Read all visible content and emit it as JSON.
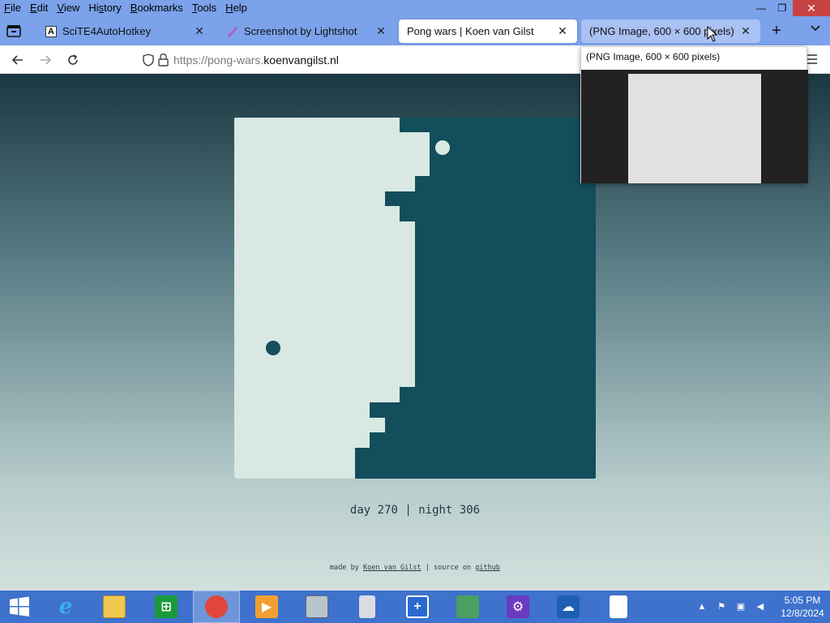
{
  "menu": {
    "items": [
      "File",
      "Edit",
      "View",
      "History",
      "Bookmarks",
      "Tools",
      "Help"
    ],
    "mnemonics": [
      "F",
      "E",
      "V",
      "s",
      "B",
      "T",
      "H"
    ]
  },
  "window": {
    "minimize": "—",
    "restore": "❐",
    "close": "✕"
  },
  "tabs": [
    {
      "title": "SciTE4AutoHotkey",
      "favicon": "A",
      "state": "normal"
    },
    {
      "title": "Screenshot by Lightshot",
      "favicon": "feather",
      "state": "normal"
    },
    {
      "title": "Pong wars | Koen van Gilst",
      "favicon": "none",
      "state": "active"
    },
    {
      "title": "(PNG Image, 600 × 600 pixels)",
      "favicon": "none",
      "state": "hover"
    }
  ],
  "tab_close_glyph": "✕",
  "new_tab_glyph": "+",
  "url": {
    "scheme_sub": "https://pong-wars.",
    "domain": "koenvangilst.nl"
  },
  "preview": {
    "title": "(PNG Image, 600 × 600 pixels)"
  },
  "game": {
    "colors": {
      "day": "#d9e8e3",
      "night": "#124e5b"
    },
    "day_score": 270,
    "night_score": 306
  },
  "score_text": "day 270 | night 306",
  "footer": {
    "made_by": "made by",
    "author": "Koen van Gilst",
    "sep": "|",
    "source_on": "source on",
    "github": "github"
  },
  "taskbar": {
    "items": [
      "start-icon",
      "internet-explorer-icon",
      "file-explorer-icon",
      "store-icon",
      "firefox-icon",
      "media-player-icon",
      "task-manager-icon",
      "recycle-bin-icon",
      "defender-icon",
      "network-icon",
      "settings-icon",
      "onedrive-icon",
      "document-icon"
    ],
    "clock_time": "5:05 PM",
    "clock_date": "12/8/2024"
  }
}
